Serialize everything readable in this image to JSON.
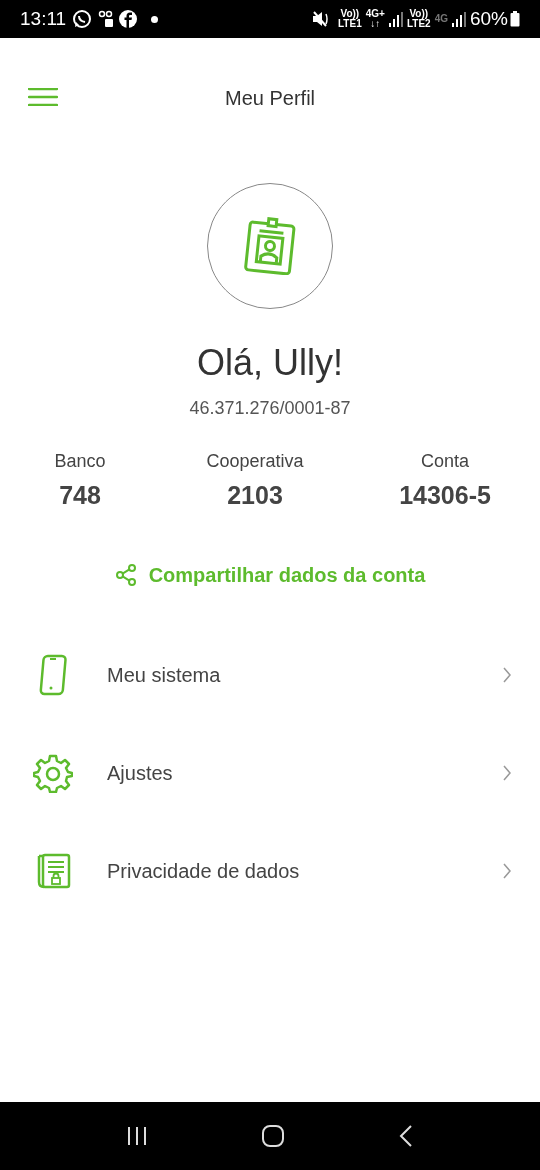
{
  "status_bar": {
    "time": "13:11",
    "network_labels": [
      {
        "top": "Vo))",
        "bottom": "LTE1",
        "dim": false
      },
      {
        "top": "4G+",
        "bottom": "↓↑",
        "dim": false
      },
      {
        "top": "Vo))",
        "bottom": "LTE2",
        "dim": false
      },
      {
        "top": "4G",
        "dim": true
      }
    ],
    "battery": "60%"
  },
  "header": {
    "title": "Meu Perfil"
  },
  "profile": {
    "greeting": "Olá, Ully!",
    "document": "46.371.276/0001-87"
  },
  "stats": [
    {
      "label": "Banco",
      "value": "748"
    },
    {
      "label": "Cooperativa",
      "value": "2103"
    },
    {
      "label": "Conta",
      "value": "14306-5"
    }
  ],
  "share_link": "Compartilhar dados da conta",
  "menu": [
    {
      "kind": "phone",
      "label": "Meu sistema"
    },
    {
      "kind": "gear",
      "label": "Ajustes"
    },
    {
      "kind": "document",
      "label": "Privacidade de dados"
    }
  ]
}
